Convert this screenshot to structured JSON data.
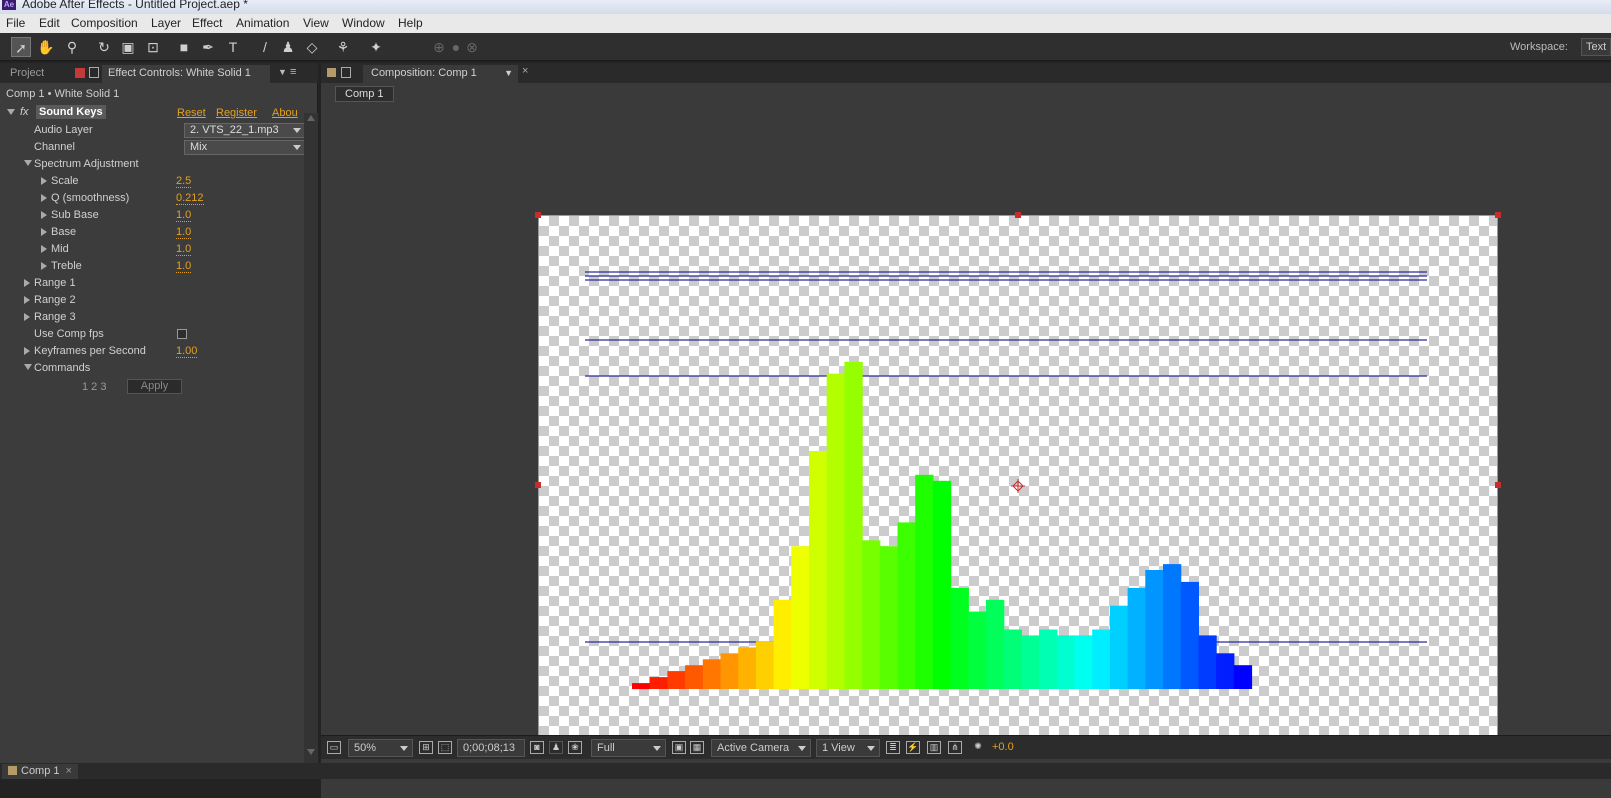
{
  "window": {
    "title": "Adobe After Effects - Untitled Project.aep *",
    "app_badge": "Ae"
  },
  "menu": [
    "File",
    "Edit",
    "Composition",
    "Layer",
    "Effect",
    "Animation",
    "View",
    "Window",
    "Help"
  ],
  "toolbar": {
    "workspace_label": "Workspace:",
    "workspace_value": "Text"
  },
  "left_panel": {
    "tab_project": "Project",
    "tab_effect_controls": "Effect Controls: White Solid 1",
    "breadcrumb": "Comp 1 • White Solid 1",
    "effect": {
      "fx": "fx",
      "name": "Sound Keys",
      "reset": "Reset",
      "register": "Register",
      "about": "Abou"
    },
    "audio_layer": {
      "label": "Audio Layer",
      "value": "2. VTS_22_1.mp3"
    },
    "channel": {
      "label": "Channel",
      "value": "Mix"
    },
    "spectrum": {
      "label": "Spectrum Adjustment",
      "params": [
        {
          "label": "Scale",
          "value": "2.5"
        },
        {
          "label": "Q (smoothness)",
          "value": "0.212"
        },
        {
          "label": "Sub Base",
          "value": "1.0"
        },
        {
          "label": "Base",
          "value": "1.0"
        },
        {
          "label": "Mid",
          "value": "1.0"
        },
        {
          "label": "Treble",
          "value": "1.0"
        }
      ]
    },
    "ranges": [
      "Range 1",
      "Range 2",
      "Range 3"
    ],
    "use_comp_fps": {
      "label": "Use Comp fps",
      "checked": false
    },
    "keyframes_per_second": {
      "label": "Keyframes per Second",
      "value": "1.00"
    },
    "commands": {
      "label": "Commands",
      "numbers": "1 2 3",
      "apply": "Apply"
    }
  },
  "composition": {
    "tab": "Composition: Comp 1",
    "mini_tab": "Comp 1",
    "spectrum_bars": [
      1,
      2,
      3,
      4,
      5,
      6,
      7,
      8,
      15,
      24,
      40,
      53,
      55,
      25,
      24,
      28,
      36,
      35,
      17,
      13,
      15,
      10,
      9,
      10,
      9,
      9,
      10,
      14,
      17,
      20,
      21,
      18,
      9,
      6,
      4
    ],
    "status": {
      "zoom": "50%",
      "timecode": "0;00;08;13",
      "resolution": "Full",
      "camera": "Active Camera",
      "views": "1 View",
      "exposure": "+0.0"
    }
  },
  "bottom": {
    "tab": "Comp 1"
  }
}
